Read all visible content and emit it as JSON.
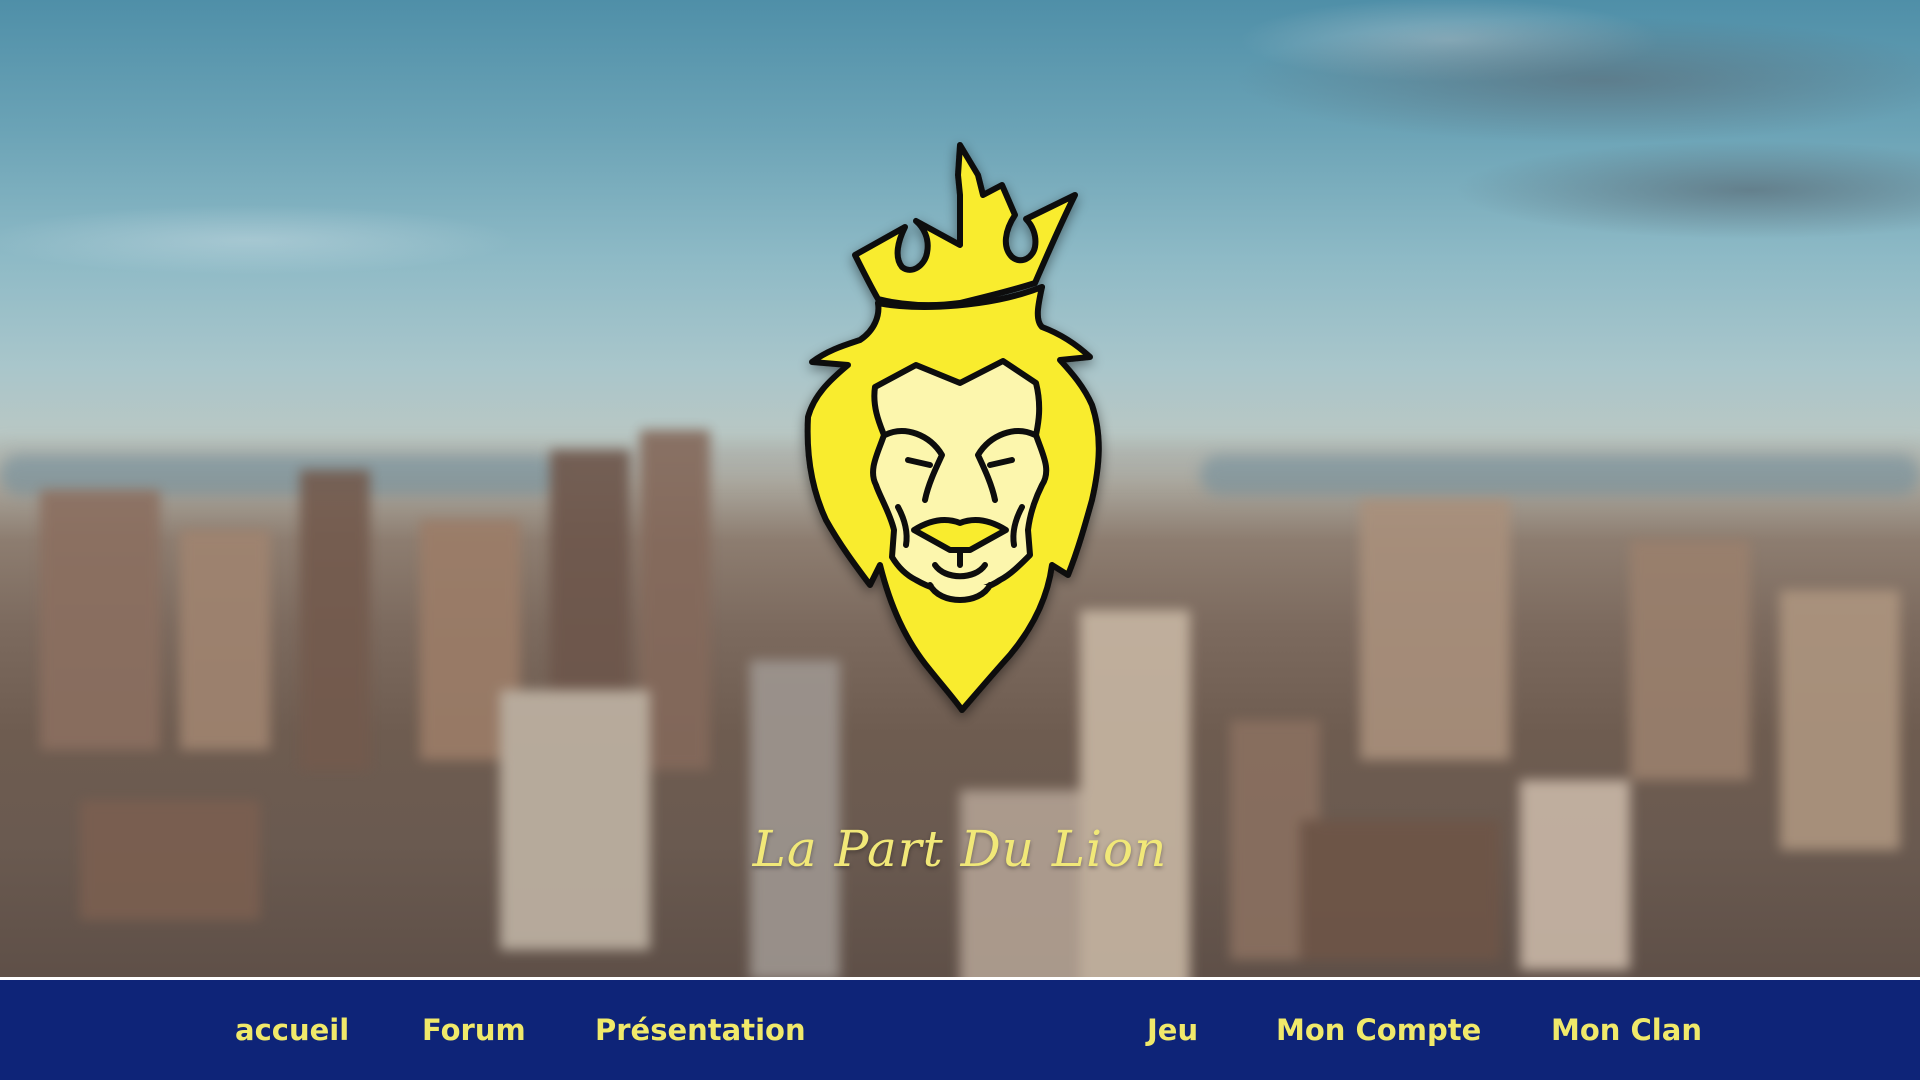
{
  "brand": {
    "tagline": "La Part Du Lion",
    "logo_icon": "crowned-lion-head-icon",
    "logo_fill": "#f9ec2e",
    "logo_face": "#fcf6ad",
    "logo_stroke": "#0b0b0b"
  },
  "nav": {
    "items": [
      {
        "label": "accueil"
      },
      {
        "label": "Forum"
      },
      {
        "label": "Présentation"
      },
      {
        "label": "Jeu"
      },
      {
        "label": "Mon Compte"
      },
      {
        "label": "Mon Clan"
      }
    ],
    "background": "#0e2478",
    "text_color": "#f0e96a"
  }
}
